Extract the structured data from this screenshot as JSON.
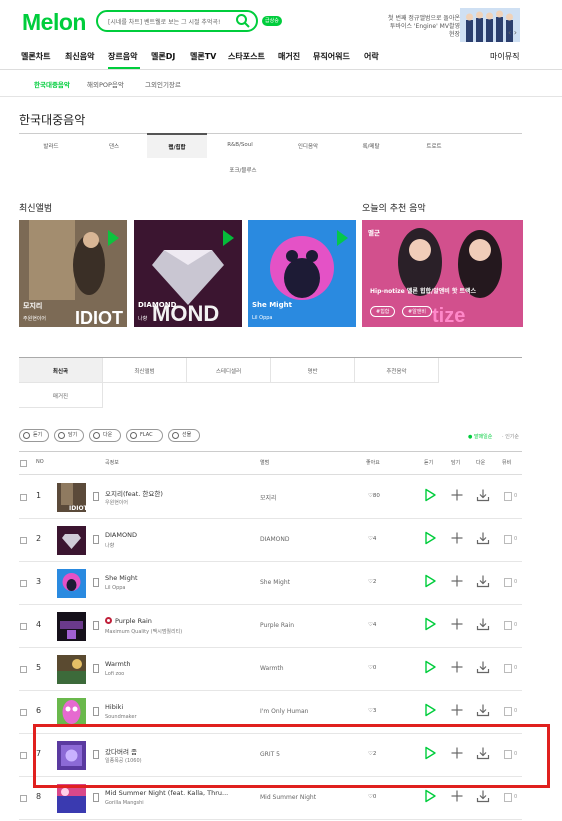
{
  "header": {
    "logo": "Melon",
    "search_value": "[시네를 차트] 벤트웰로 보는 그 시절 추억곡!",
    "meal_badge": "급상승",
    "top_noise_1": "",
    "top_noise_2": "",
    "banner_line1": "첫 번째 정규앨범으로 돌아온",
    "banner_line2": "투바이스 'Engine' MV촬영 현장",
    "banner_nav": "‹ ›"
  },
  "gnb": {
    "items": [
      "멜론차트",
      "최신음악",
      "장르음악",
      "멜론DJ",
      "멜론TV",
      "스타포스트",
      "매거진",
      "뮤직어워드",
      "어락"
    ],
    "my_music": "마이뮤직"
  },
  "lnb": {
    "items": [
      "한국대중음악",
      "해외POP음악",
      "그외인기장르"
    ]
  },
  "page_title": "한국대중음악",
  "genres": {
    "row1": [
      "발라드",
      "댄스",
      "랩/힙합",
      "R&B/Soul",
      "인디음악",
      "록/메탈",
      "트로트"
    ],
    "row2": [
      "포크/블루스"
    ]
  },
  "latest_albums": {
    "title": "최신앨범",
    "items": [
      {
        "title": "모지리",
        "artist": "주원현이어"
      },
      {
        "title": "DIAMOND",
        "artist": "나향"
      },
      {
        "title": "She Might",
        "artist": "Lil Oppa"
      }
    ]
  },
  "recommend": {
    "title": "오늘의 추천 음악",
    "badge": "멜군",
    "text": "Hip-notize 멜론 힙합/알앤비 핫 트랙스",
    "tag1": "#힙합",
    "tag2": "#알앤비"
  },
  "tabs": [
    "최신곡",
    "최신앨범",
    "스테디셀러",
    "명반",
    "추천음악",
    "매거진"
  ],
  "buttons": [
    "듣기",
    "담기",
    "다운",
    "FLAC",
    "선물"
  ],
  "sort": {
    "on": "발매일순",
    "off": "인기순"
  },
  "list_headers": {
    "no": "NO",
    "song": "곡정보",
    "album": "앨범",
    "like": "좋아요",
    "listen": "듣기",
    "add": "담기",
    "down": "다운",
    "mv": "뮤비"
  },
  "songs": [
    {
      "rank": "1",
      "title": "오지리(feat. 한요한)",
      "artist": "우원현이어",
      "album": "모지리",
      "like": "♡80"
    },
    {
      "rank": "2",
      "title": "DIAMOND",
      "artist": "나향",
      "album": "DIAMOND",
      "like": "♡4"
    },
    {
      "rank": "3",
      "title": "She Might",
      "artist": "Lil Oppa",
      "album": "She Might",
      "like": "♡2"
    },
    {
      "rank": "4",
      "title": "Purple Rain",
      "artist": "Maximum Quality (맥시멈퀄리티)",
      "album": "Purple Rain",
      "like": "♡4"
    },
    {
      "rank": "5",
      "title": "Warmth",
      "artist": "Lofi zoo",
      "album": "Warmth",
      "like": "♡0"
    },
    {
      "rank": "6",
      "title": "Hibiki",
      "artist": "Soundmaker",
      "album": "I'm Only Human",
      "like": "♡3"
    },
    {
      "rank": "7",
      "title": "갔다버려 좀",
      "artist": "일종목공 (1060)",
      "album": "GRIT 5",
      "like": "♡2"
    },
    {
      "rank": "8",
      "title": "Mid Summer Night (feat. Kalla, Thru...",
      "artist": "Gorilla Mangshi",
      "album": "Mid Summer Night",
      "like": "♡0"
    }
  ],
  "mv_counts": [
    "0",
    "0",
    "0",
    "0",
    "0",
    "0",
    "0",
    "0"
  ],
  "colors": {
    "brand": "#00cd3c",
    "highlight": "#e0201e"
  }
}
